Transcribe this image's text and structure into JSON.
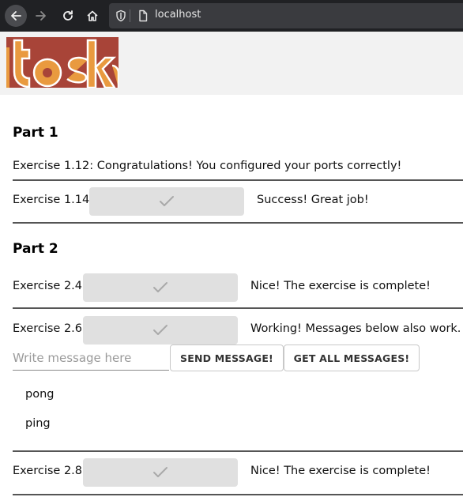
{
  "browser": {
    "url": "localhost"
  },
  "logo": {
    "brand_colors": [
      "#a84438",
      "#e99a3f"
    ]
  },
  "part1": {
    "heading": "Part 1",
    "ex_112": "Exercise 1.12: Congratulations! You configured your ports correctly!",
    "ex_114_label": "Exercise 1.14:",
    "ex_114_status": "Success! Great job!"
  },
  "part2": {
    "heading": "Part 2",
    "ex_24_label": "Exercise 2.4:",
    "ex_24_status": "Nice! The exercise is complete!",
    "ex_26_label": "Exercise 2.6:",
    "ex_26_status": "Working! Messages below also work.",
    "message_input": {
      "placeholder": "Write message here",
      "value": ""
    },
    "send_button": "SEND MESSAGE!",
    "get_all_button": "GET ALL MESSAGES!",
    "messages": [
      "pong",
      "ping"
    ],
    "ex_28_label": "Exercise 2.8:",
    "ex_28_status": "Nice! The exercise is complete!"
  }
}
